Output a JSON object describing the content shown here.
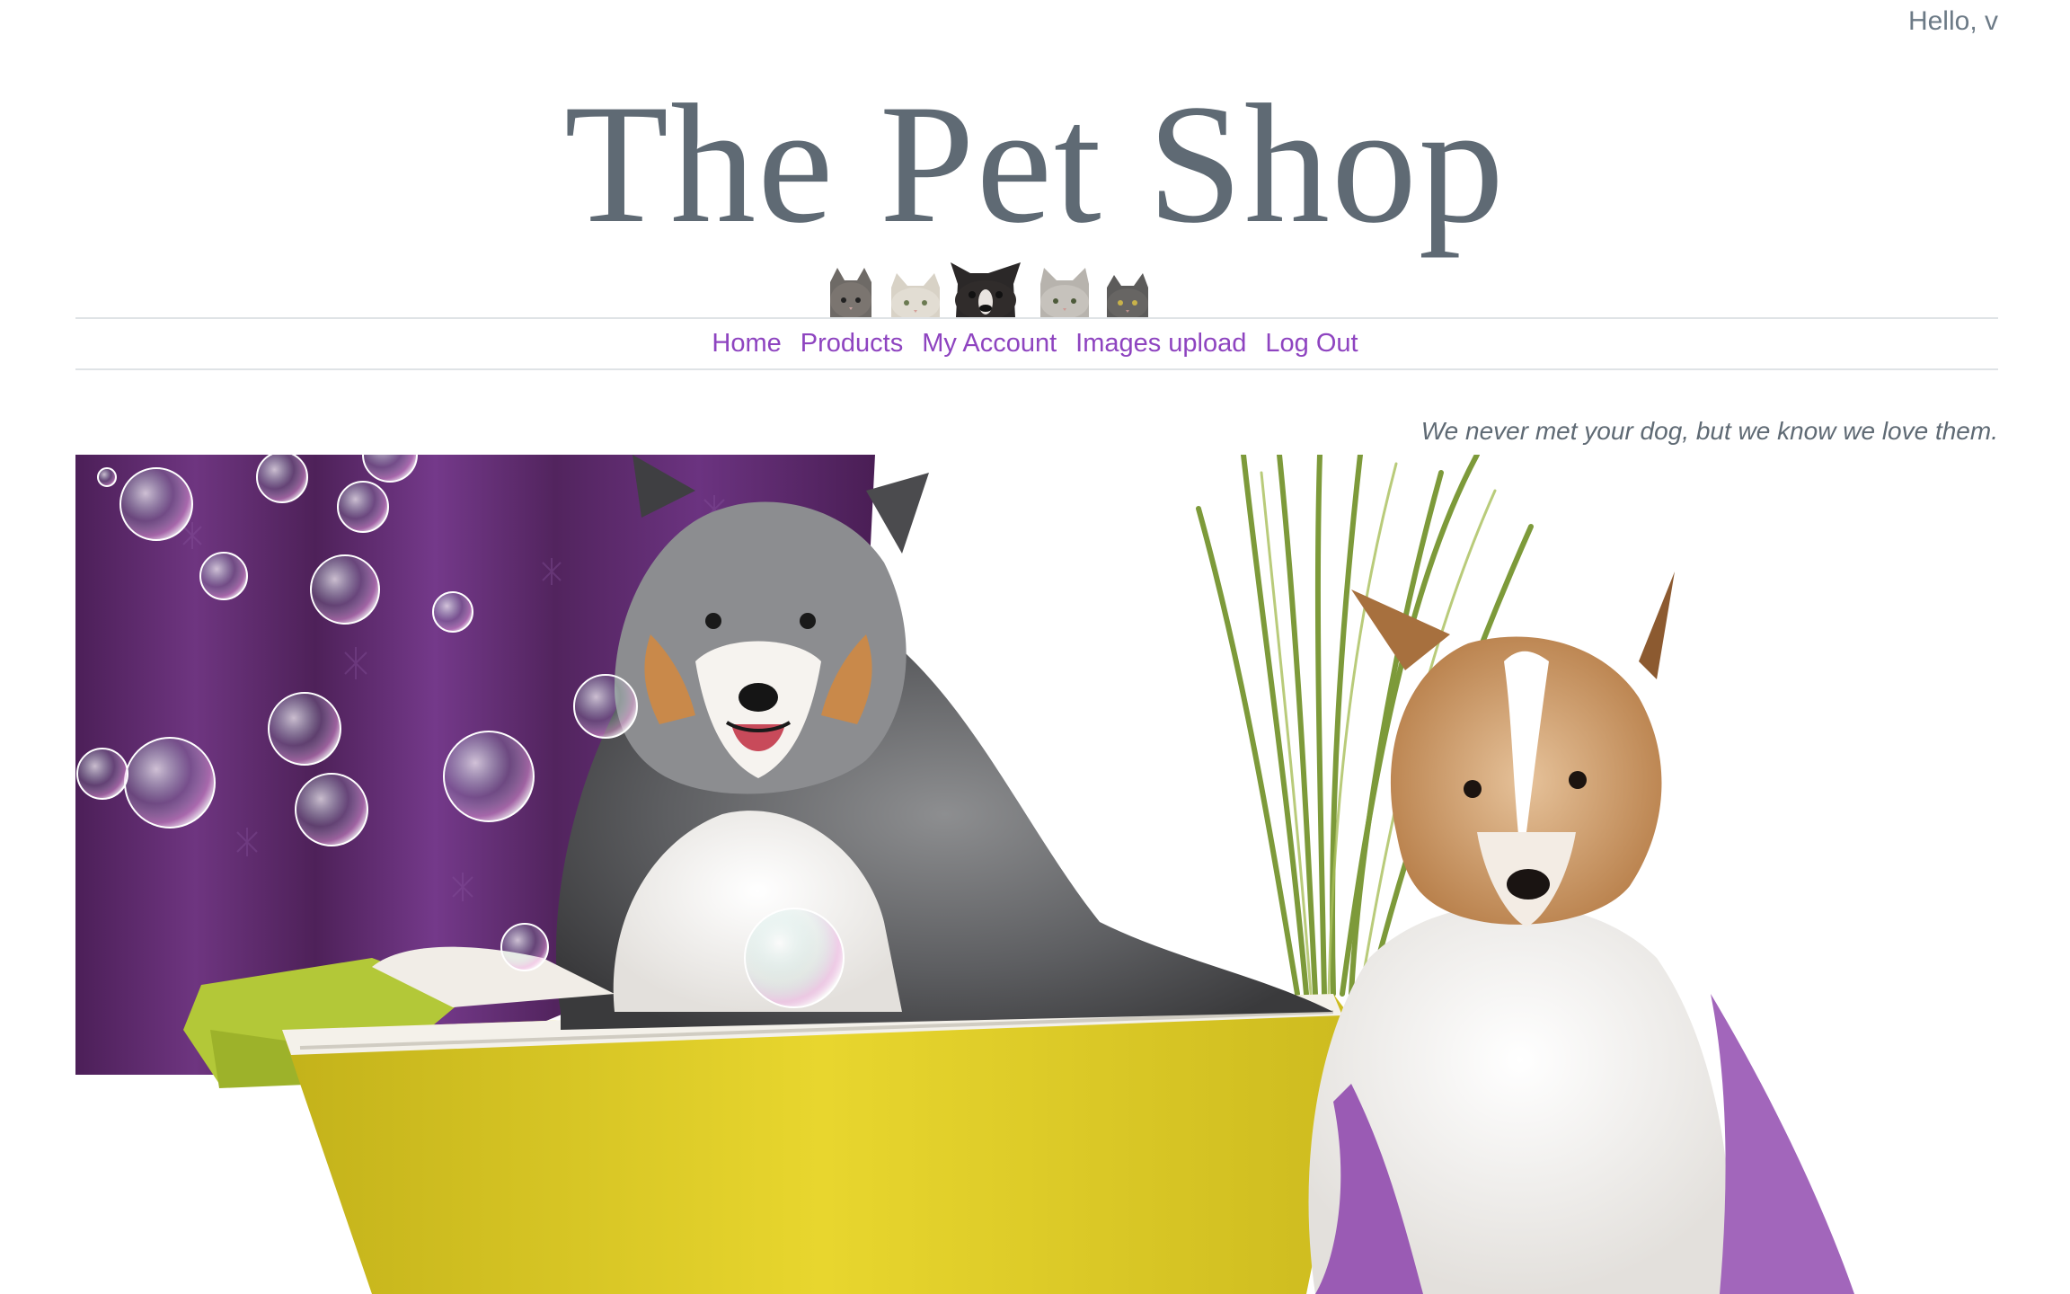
{
  "header": {
    "greeting": "Hello, v",
    "site_title": "The Pet Shop"
  },
  "nav": {
    "items": [
      {
        "label": "Home"
      },
      {
        "label": "Products"
      },
      {
        "label": "My Account"
      },
      {
        "label": "Images upload"
      },
      {
        "label": "Log Out"
      }
    ]
  },
  "main": {
    "tagline": "We never met your dog, but we know we love them."
  },
  "colors": {
    "title": "#5f6a74",
    "nav_link": "#8e44c0",
    "rule": "#dfe3e6",
    "curtain": "#5e2a6b",
    "tub": "#d9c92a",
    "towel": "#b8cf3a",
    "robe": "#9a5bb4"
  },
  "icons": {
    "pets_banner": "pets-peeking-icon",
    "hero": "dogs-bath-hero-image"
  }
}
